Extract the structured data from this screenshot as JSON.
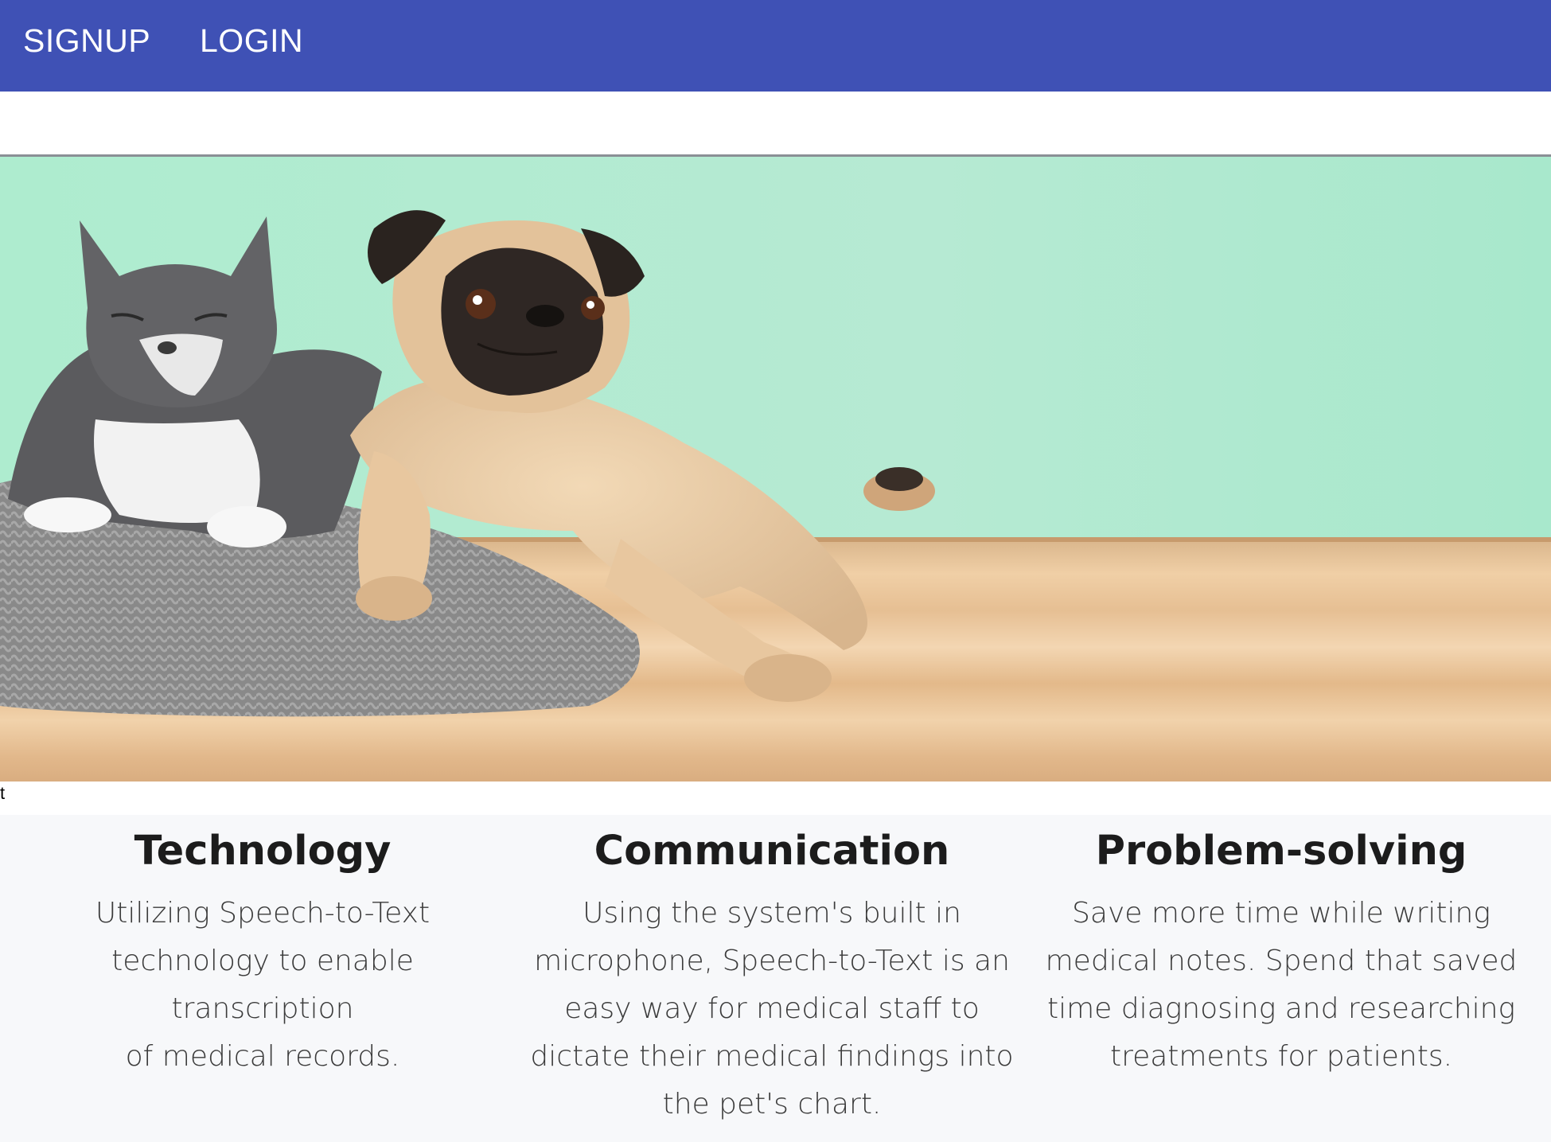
{
  "nav": {
    "signup_label": "SIGNUP",
    "login_label": "LOGIN"
  },
  "colors": {
    "appbar": "#3f51b5",
    "features_bg": "#f7f8fa",
    "hero_wall": "#a9ecd0"
  },
  "stray_text": "t",
  "features": [
    {
      "title": "Technology",
      "text_lines": [
        "Utilizing Speech-to-Text",
        "technology to enable transcription",
        "of medical records."
      ]
    },
    {
      "title": "Communication",
      "text_lines": [
        "Using the system's built in",
        "microphone, Speech-to-Text is an",
        "easy way for medical staff to",
        "dictate their medical findings into",
        "the pet's chart."
      ]
    },
    {
      "title": "Problem-solving",
      "text_lines": [
        "Save more time while writing",
        "medical notes. Spend that saved",
        "time diagnosing and researching",
        "treatments for patients."
      ]
    }
  ]
}
